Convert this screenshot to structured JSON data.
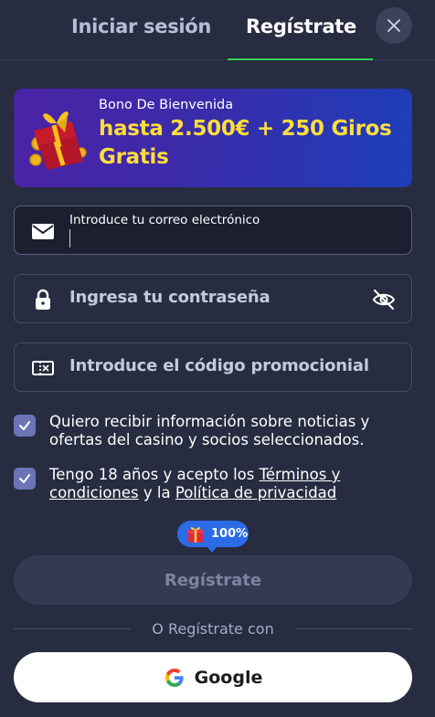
{
  "tabs": {
    "login_label": "Iniciar sesión",
    "register_label": "Regístrate",
    "active": "register"
  },
  "close_icon": "close-icon",
  "banner": {
    "subtitle": "Bono De Bienvenida",
    "title": "hasta 2.500€ + 250 Giros Gratis",
    "icon": "gift-box-icon"
  },
  "form": {
    "email": {
      "label": "Introduce tu correo electrónico",
      "value": "",
      "icon": "envelope-icon"
    },
    "password": {
      "placeholder": "Ingresa tu contraseña",
      "icon": "lock-icon",
      "toggle_icon": "eye-slash-icon"
    },
    "promo": {
      "placeholder": "Introduce el código promocionial",
      "icon": "ticket-icon"
    },
    "consent_marketing": {
      "checked": true,
      "text": "Quiero recibir información sobre noticias y ofertas del casino y socios seleccionados."
    },
    "consent_terms": {
      "checked": true,
      "text_before": "Tengo 18 años y acepto los ",
      "terms_link": "Términos y condiciones",
      "text_middle": " y la ",
      "privacy_link": "Política de privacidad"
    },
    "bonus_badge": "100%",
    "submit_label": "Regístrate"
  },
  "social": {
    "divider_text": "O Regístrate con",
    "google_label": "Google"
  },
  "colors": {
    "background": "#272c41",
    "tab_underline": "#39d353",
    "banner_title": "#ffdd3c",
    "checkbox": "#6c74b6",
    "bonus_pill": "#2b6be6"
  }
}
